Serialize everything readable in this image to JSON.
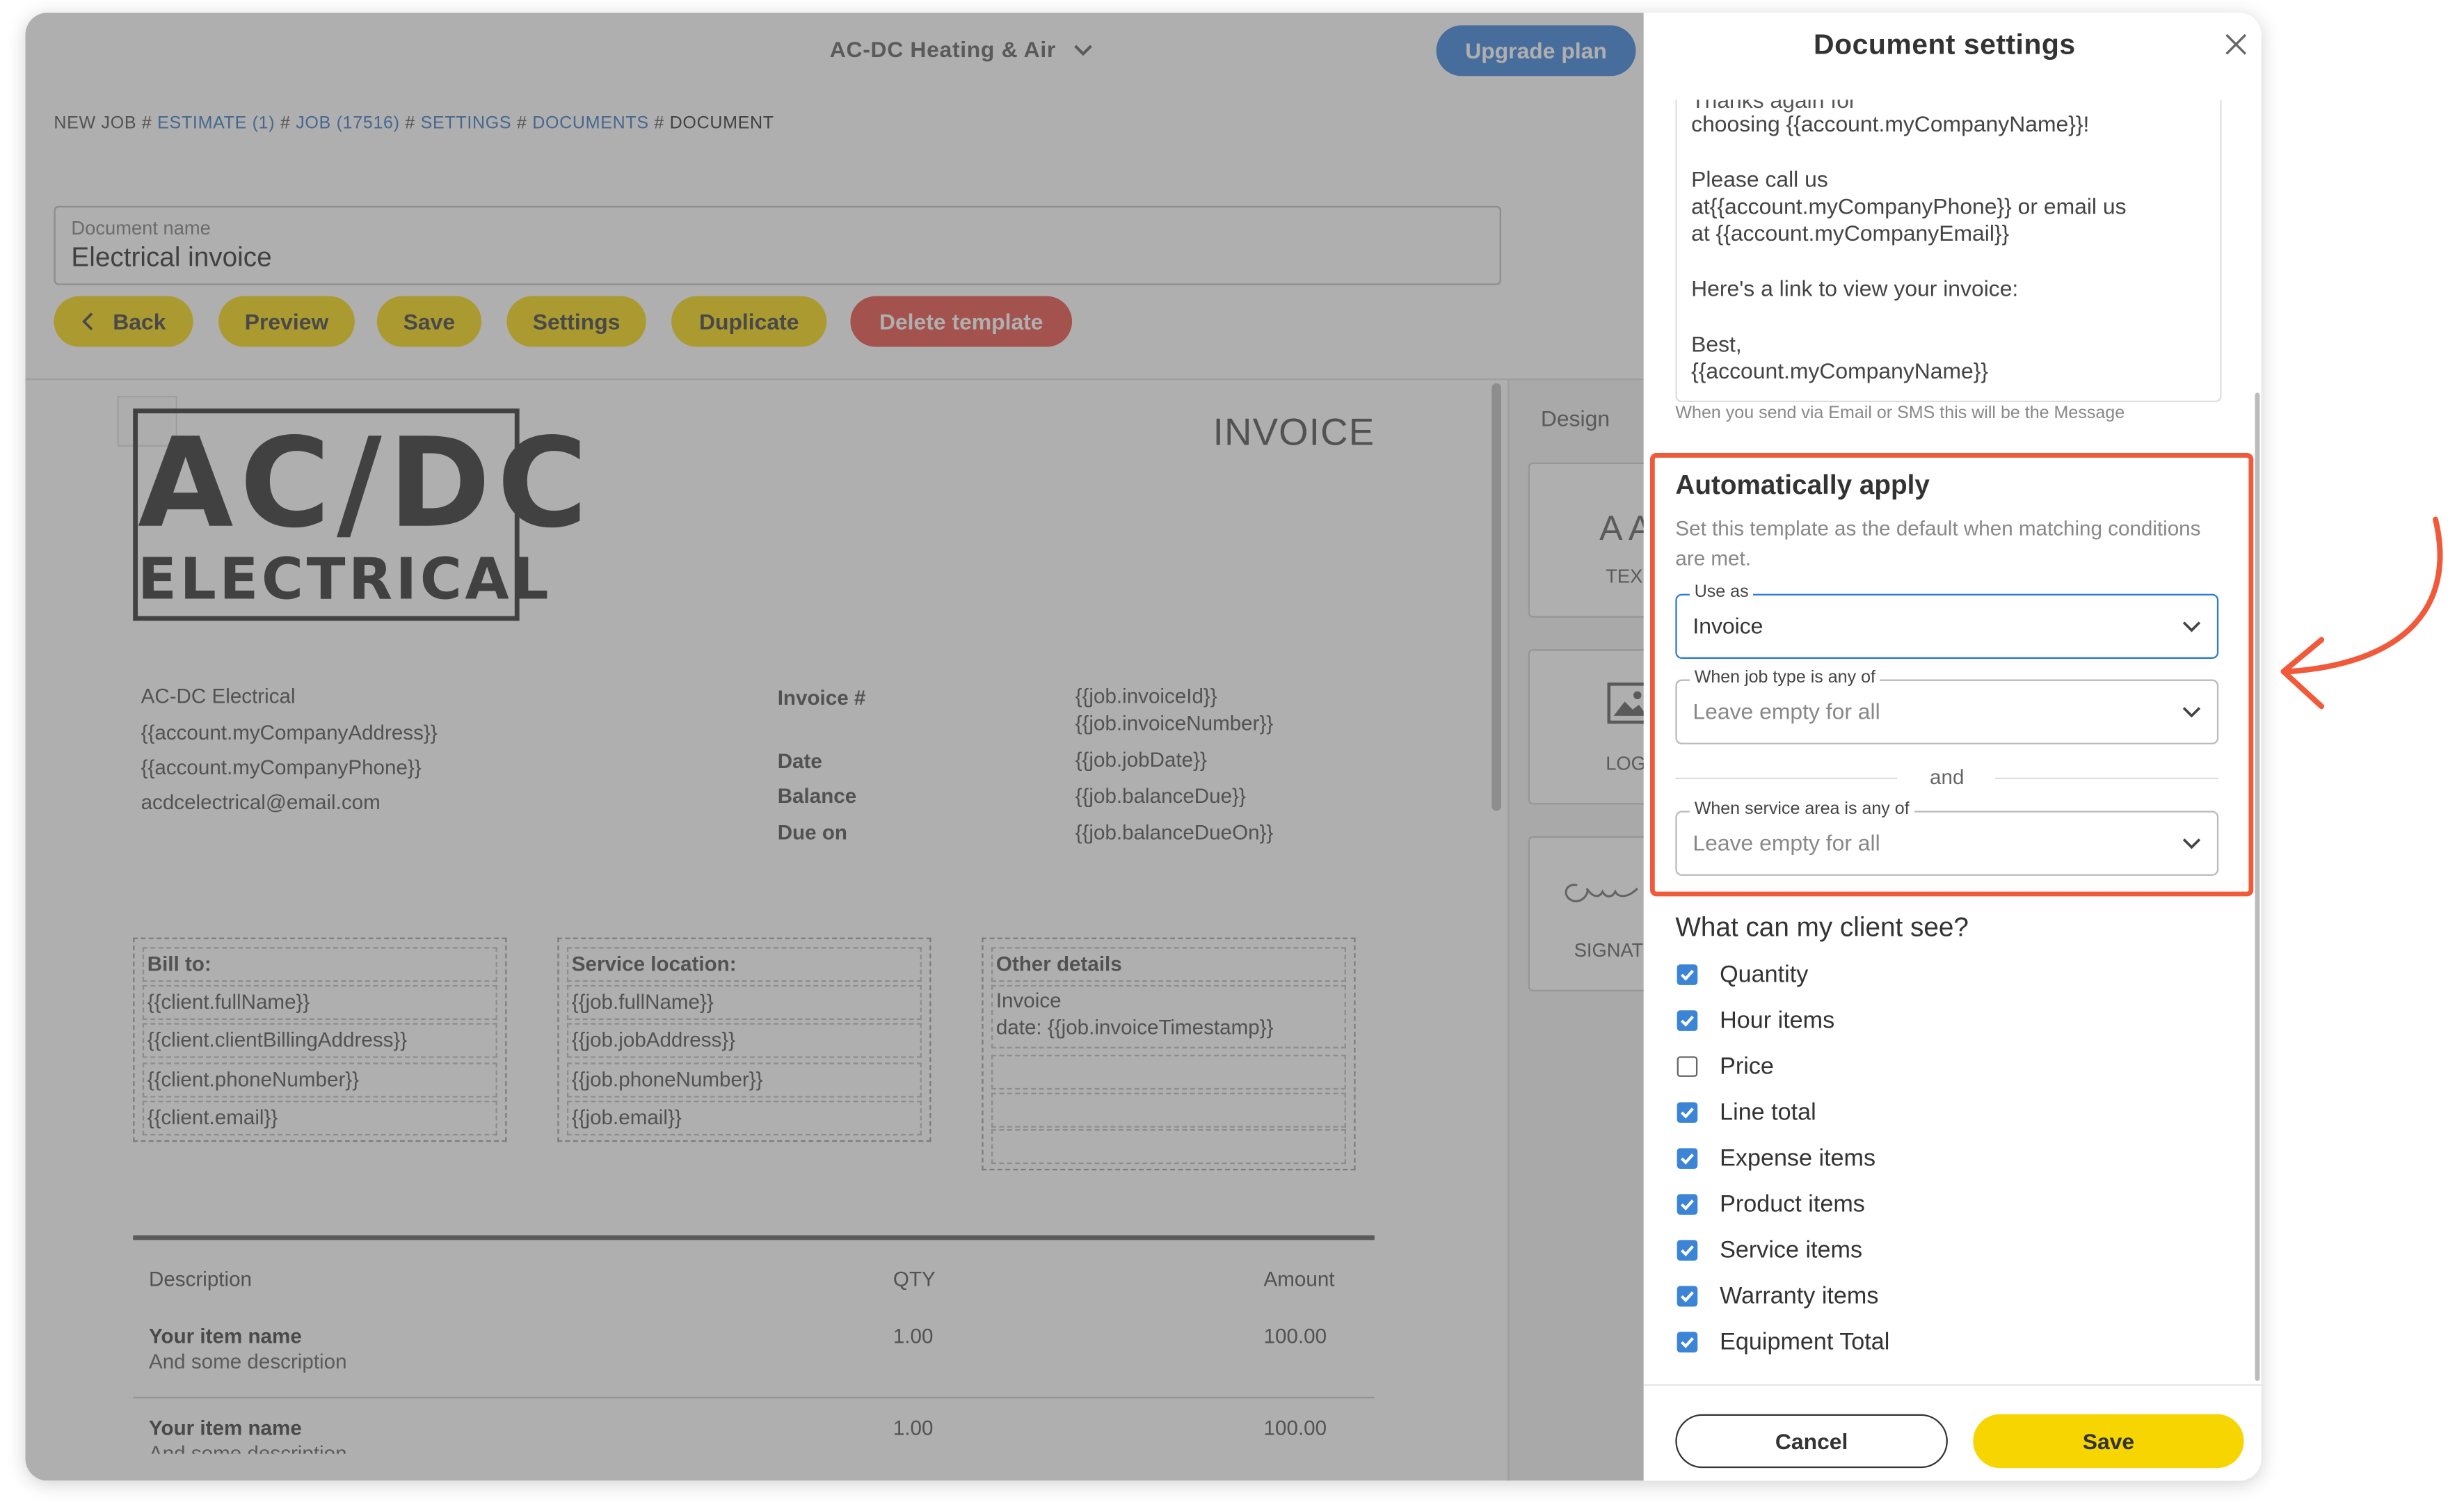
{
  "header": {
    "company": "AC-DC Heating & Air",
    "upgrade_label": "Upgrade plan"
  },
  "breadcrumb": {
    "items": [
      "NEW JOB",
      "ESTIMATE (1)",
      "JOB (17516)",
      "SETTINGS",
      "DOCUMENTS",
      "DOCUMENT"
    ],
    "separator": "#"
  },
  "document_name": {
    "label": "Document name",
    "value": "Electrical invoice"
  },
  "toolbar": {
    "back": "Back",
    "preview": "Preview",
    "save": "Save",
    "settings": "Settings",
    "duplicate": "Duplicate",
    "delete": "Delete template"
  },
  "design_panel": {
    "tab": "Design",
    "cards": [
      "TEX",
      "LOG",
      "SIGNAT"
    ],
    "text_glyph": "A A"
  },
  "invoice": {
    "logo_line1": "AC/DC",
    "logo_line2": "ELECTRICAL",
    "title": "INVOICE",
    "company_lines": [
      "AC-DC Electrical",
      "{{account.myCompanyAddress}}",
      "{{account.myCompanyPhone}}",
      "acdcelectrical@email.com"
    ],
    "meta_labels": [
      "Invoice #",
      "Date",
      "Balance",
      "Due on"
    ],
    "meta_values": [
      "{{job.invoiceId}}",
      "{{job.invoiceNumber}}",
      "{{job.jobDate}}",
      "{{job.balanceDue}}",
      "{{job.balanceDueOn}}"
    ],
    "bill_to": [
      "Bill to:",
      "{{client.fullName}}",
      "{{client.clientBillingAddress}}",
      "{{client.phoneNumber}}",
      "{{client.email}}"
    ],
    "service_location": [
      "Service location:",
      "{{job.fullName}}",
      "{{job.jobAddress}}",
      "{{job.phoneNumber}}",
      "{{job.email}}"
    ],
    "other_details": [
      "Other details",
      "Invoice",
      "date: {{job.invoiceTimestamp}}"
    ],
    "table_headers": [
      "Description",
      "QTY",
      "Amount"
    ],
    "rows": [
      {
        "name": "Your item name",
        "desc": "And some description",
        "qty": "1.00",
        "amount": "100.00"
      },
      {
        "name": "Your item name",
        "desc": "And some description",
        "qty": "1.00",
        "amount": "100.00"
      }
    ]
  },
  "panel": {
    "title": "Document settings",
    "message_lines": [
      "Thanks again for",
      "choosing {{account.myCompanyName}}!",
      "Please call us",
      "at{{account.myCompanyPhone}} or email us",
      "at {{account.myCompanyEmail}}",
      "Here's a link to view your invoice:",
      "Best,",
      "{{account.myCompanyName}}"
    ],
    "message_hint": "When you send via Email or SMS this will be the Message",
    "auto_apply": {
      "title": "Automatically apply",
      "description": "Set this template as the default when matching conditions are met.",
      "use_as_label": "Use as",
      "use_as_value": "Invoice",
      "job_type_label": "When job type is any of",
      "job_type_placeholder": "Leave empty for all",
      "and_label": "and",
      "service_area_label": "When service area is any of",
      "service_area_placeholder": "Leave empty for all"
    },
    "visibility": {
      "title": "What can my client see?",
      "items": [
        {
          "label": "Quantity",
          "checked": true
        },
        {
          "label": "Hour items",
          "checked": true
        },
        {
          "label": "Price",
          "checked": false
        },
        {
          "label": "Line total",
          "checked": true
        },
        {
          "label": "Expense items",
          "checked": true
        },
        {
          "label": "Product items",
          "checked": true
        },
        {
          "label": "Service items",
          "checked": true
        },
        {
          "label": "Warranty items",
          "checked": true
        },
        {
          "label": "Equipment Total",
          "checked": true
        }
      ]
    },
    "cancel_label": "Cancel",
    "save_label": "Save"
  },
  "colors": {
    "accent_yellow": "#f6d500",
    "brand_blue": "#2d7bd6",
    "danger_red": "#e8453c",
    "highlight_orange": "#f05a3a",
    "checkbox_blue": "#3b84d6"
  }
}
